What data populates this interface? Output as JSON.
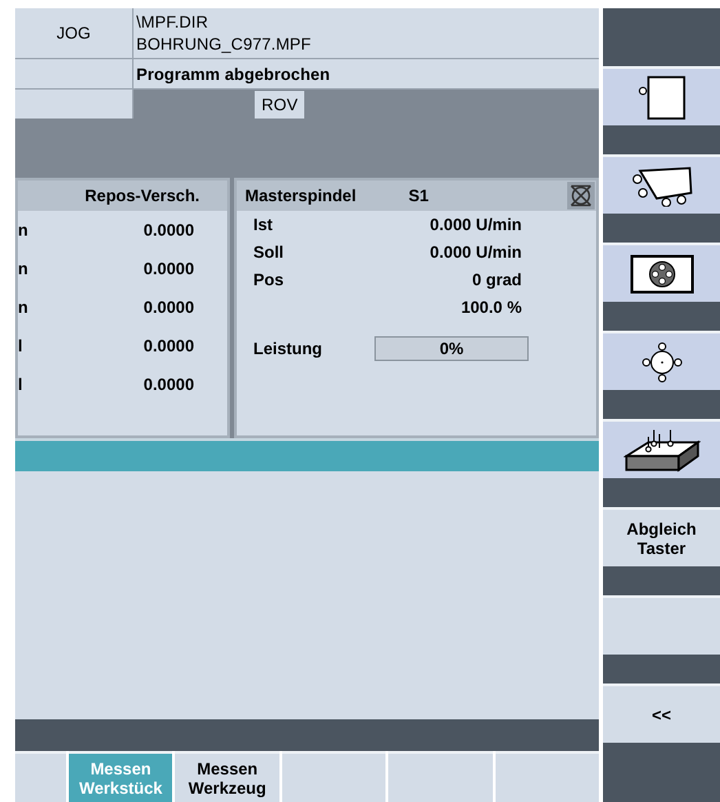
{
  "header": {
    "mode": "JOG",
    "path": "\\MPF.DIR",
    "program": "BOHRUNG_C977.MPF",
    "status": "Programm abgebrochen",
    "rov": "ROV"
  },
  "repos": {
    "title": "Repos-Versch.",
    "rows": [
      {
        "axis": "n",
        "value": "0.0000"
      },
      {
        "axis": "n",
        "value": "0.0000"
      },
      {
        "axis": "n",
        "value": "0.0000"
      },
      {
        "axis": "l",
        "value": "0.0000"
      },
      {
        "axis": "l",
        "value": "0.0000"
      }
    ]
  },
  "spindle": {
    "title": "Masterspindel",
    "name": "S1",
    "rows": [
      {
        "label": "Ist",
        "value": "0.000 U/min"
      },
      {
        "label": "Soll",
        "value": "0.000 U/min"
      },
      {
        "label": "Pos",
        "value": "0 grad"
      },
      {
        "value": "100.0 %"
      }
    ],
    "power": {
      "label": "Leistung",
      "reading": "0%",
      "level": 0
    }
  },
  "vertical_softkeys": [
    {
      "kind": "frame"
    },
    {
      "kind": "edge"
    },
    {
      "kind": "circle"
    },
    {
      "kind": "center"
    },
    {
      "kind": "block"
    },
    {
      "kind": "text",
      "label": "Abgleich\nTaster"
    },
    {
      "kind": "empty"
    },
    {
      "kind": "text",
      "label": "<<"
    }
  ],
  "horizontal_softkeys": [
    {
      "selected": false
    },
    {
      "label": "Messen\nWerkstück",
      "selected": true
    },
    {
      "label": "Messen\nWerkzeug",
      "selected": false
    },
    {
      "selected": false
    },
    {
      "selected": false
    },
    {
      "selected": false
    }
  ]
}
